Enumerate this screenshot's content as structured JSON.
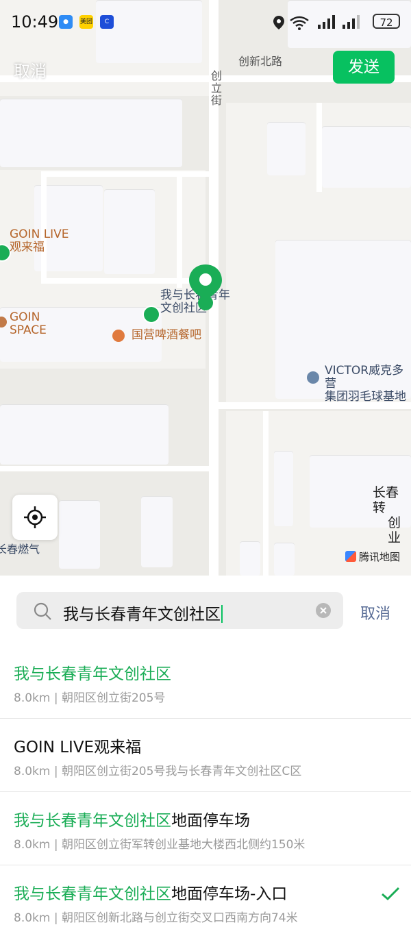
{
  "status": {
    "time": "10:49",
    "apps": [
      "messages",
      "美团",
      "c-app"
    ],
    "battery": "72"
  },
  "header": {
    "cancel_label": "取消",
    "send_label": "发送"
  },
  "map": {
    "roads": {
      "north": "创新北路",
      "street": "创\n立\n街"
    },
    "pois": {
      "goin_live_1": "GOIN LIVE",
      "goin_live_2": "观来福",
      "goin_space_1": "GOIN",
      "goin_space_2": "SPACE",
      "community_1": "我与长春青年",
      "community_2": "文创社区",
      "pub": "国营啤酒餐吧",
      "victor_1": "VICTOR威克多营",
      "victor_2": "集团羽毛球基地",
      "changchun_1": "长春转",
      "changchun_2": "创业",
      "gas": "长春燃气"
    },
    "provider": "腾讯地图"
  },
  "search": {
    "value": "我与长春青年文创社区",
    "cancel_label": "取消"
  },
  "results": [
    {
      "highlight": "我与长春青年文创社区",
      "rest": "",
      "sub": "8.0km | 朝阳区创立街205号"
    },
    {
      "highlight": "",
      "rest": "GOIN LIVE观来福",
      "sub": "8.0km | 朝阳区创立街205号我与长春青年文创社区C区"
    },
    {
      "highlight": "我与长春青年文创社区",
      "rest": "地面停车场",
      "sub": "8.0km | 朝阳区创立街军转创业基地大楼西北侧约150米"
    },
    {
      "highlight": "我与长春青年文创社区",
      "rest": "地面停车场-入口",
      "sub": "8.0km | 朝阳区创新北路与创立街交叉口西南方向74米"
    }
  ],
  "colors": {
    "accent": "#07c160",
    "highlight": "#1aad56",
    "link": "#576b95",
    "poi": "#b5652a",
    "label": "#3b4b66"
  }
}
